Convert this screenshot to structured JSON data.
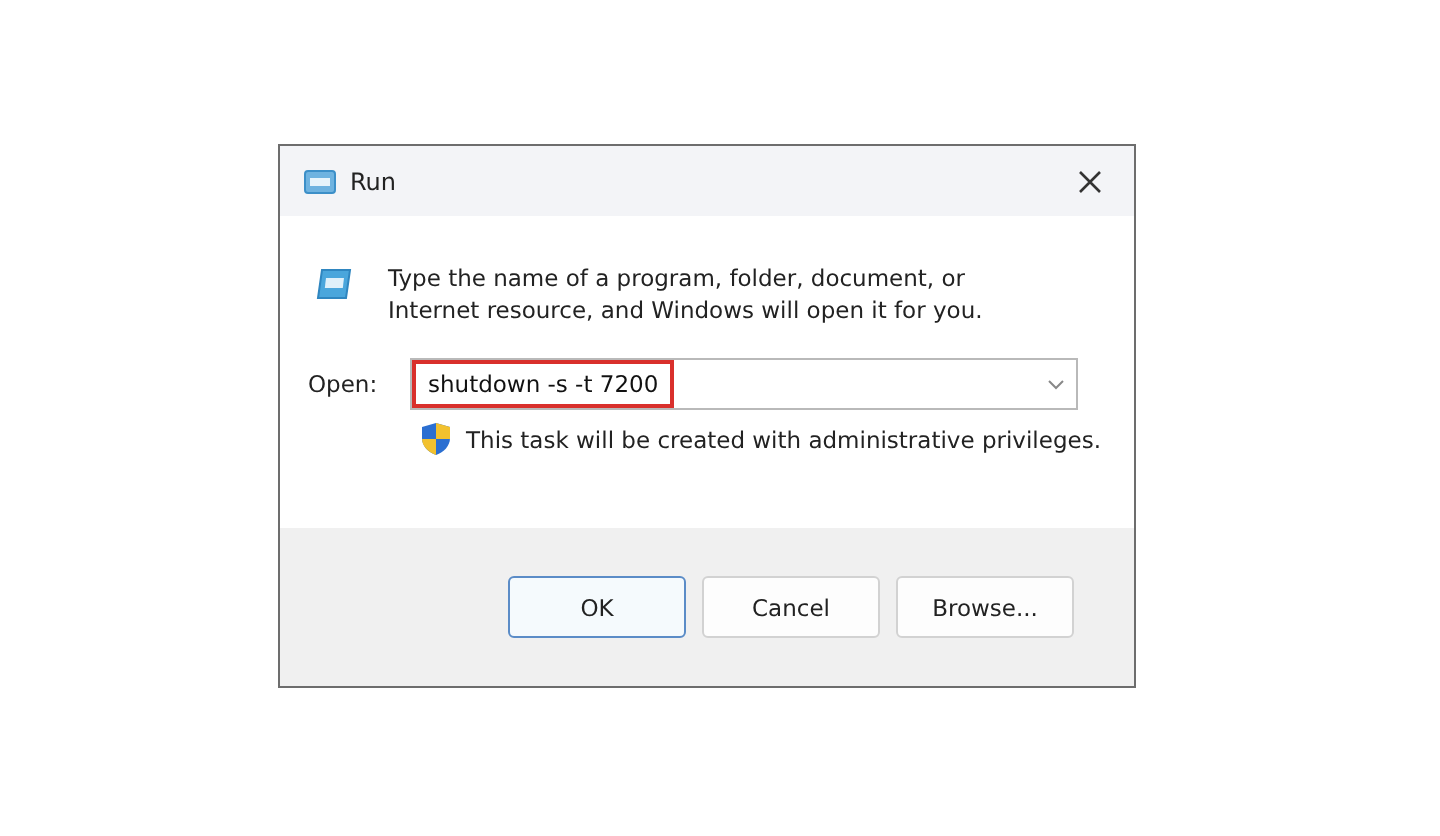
{
  "window": {
    "title": "Run"
  },
  "description": "Type the name of a program, folder, document, or Internet resource, and Windows will open it for you.",
  "open_field": {
    "label": "Open:",
    "value": "shutdown -s -t 7200",
    "highlighted": true
  },
  "admin_note": "This task will be created with administrative privileges.",
  "buttons": [
    {
      "label": "OK",
      "default": true
    },
    {
      "label": "Cancel",
      "default": false
    },
    {
      "label": "Browse...",
      "default": false
    }
  ]
}
